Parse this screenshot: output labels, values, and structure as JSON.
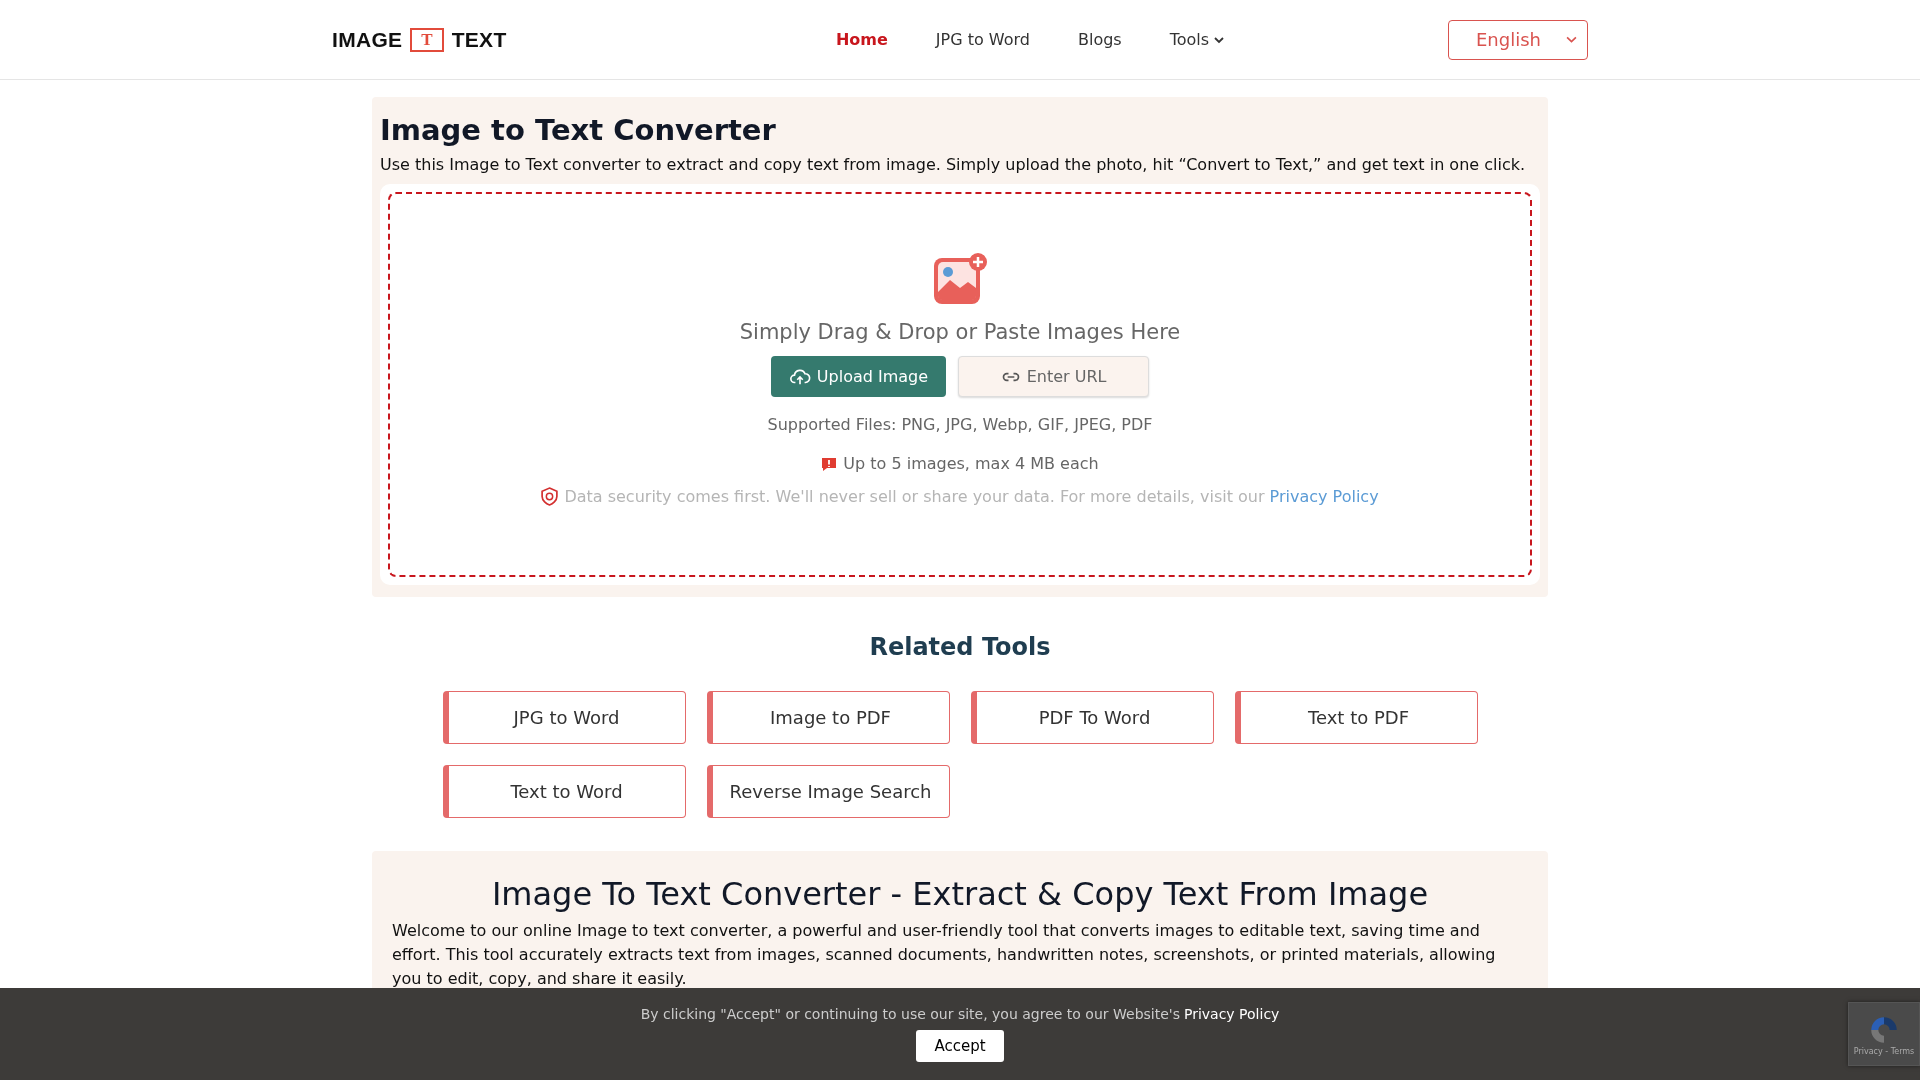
{
  "header": {
    "logo": {
      "left": "IMAGE",
      "mark": "T",
      "right": "TEXT"
    },
    "nav": [
      {
        "label": "Home",
        "selected": true
      },
      {
        "label": "JPG to Word",
        "selected": false
      },
      {
        "label": "Blogs",
        "selected": false
      },
      {
        "label": "Tools",
        "selected": false,
        "kind": "dropdown"
      }
    ],
    "language": "English"
  },
  "converter": {
    "title": "Image to Text Converter",
    "description": "Use this Image to Text converter to extract and copy text from image. Simply upload the photo, hit “Convert to Text,” and get text in one click.",
    "drop_label": "Simply Drag & Drop or Paste Images Here",
    "upload_button": "Upload Image",
    "url_button": "Enter URL",
    "supported": "Supported Files: PNG, JPG, Webp, GIF, JPEG, PDF",
    "limit": "Up to 5 images, max 4 MB each",
    "security": "Data security comes first. We'll never sell or share your data. For more details, visit our",
    "privacy_link": "Privacy Policy"
  },
  "related": {
    "title": "Related Tools",
    "tools": [
      "JPG to Word",
      "Image to PDF",
      "PDF To Word",
      "Text to PDF",
      "Text to Word",
      "Reverse Image Search"
    ]
  },
  "article": {
    "title": "Image To Text Converter - Extract & Copy Text From Image",
    "paragraphs": [
      "Welcome to our online Image to text converter, a powerful and user-friendly tool that converts images to editable text, saving time and effort. This tool accurately extracts text from images, scanned documents, handwritten notes, screenshots, or printed materials, allowing you to edit, copy, and share it easily."
    ]
  },
  "cookie_bar": {
    "text": "By clicking \"Accept\" or continuing to use our site, you agree to our Website's",
    "link": "Privacy Policy",
    "button": "Accept"
  },
  "recaptcha": {
    "label": "Privacy - Terms"
  }
}
